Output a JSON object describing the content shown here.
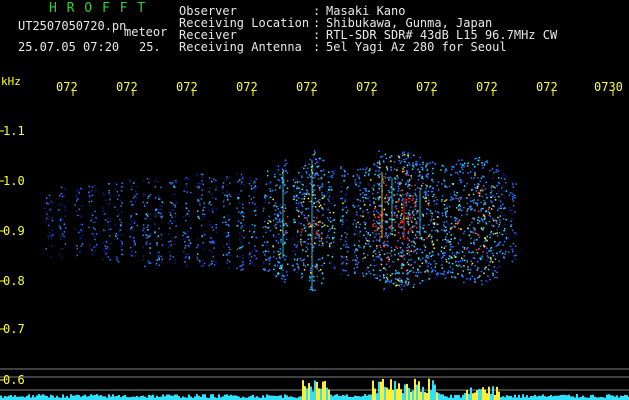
{
  "header": {
    "logo": "H R O F F T",
    "file_name": "UT2507050720.pn",
    "tag": "meteor",
    "datetime": "25.07.05 07:20",
    "frame_id": "25.",
    "fields": [
      {
        "label": "Observer",
        "sep": ":",
        "value": "Masaki Kano"
      },
      {
        "label": "Receiving Location",
        "sep": ":",
        "value": "Shibukawa, Gunma, Japan"
      },
      {
        "label": "Receiver",
        "sep": ":",
        "value": "RTL-SDR SDR# 43dB L15 96.7MHz CW"
      },
      {
        "label": "Receiving Antenna",
        "sep": ":",
        "value": "5el Yagi Az 280 for Seoul"
      }
    ]
  },
  "time_axis": {
    "labels": [
      "072",
      "072",
      "072",
      "072",
      "072",
      "072",
      "072",
      "072",
      "072",
      "0730"
    ]
  },
  "freq_axis": {
    "unit": "kHz",
    "labels": [
      "1.1",
      "1.0",
      "0.9",
      "0.8",
      "0.7",
      "0.6"
    ]
  },
  "colors": {
    "background": "#000000",
    "label": "#ffff30",
    "header_text": "#e8e8e8",
    "logo": "#2fd02f",
    "signal_low": "#10208a",
    "signal_mid": "#2f7bff",
    "signal_high": "#30e0ff",
    "signal_peak": "#ffef30",
    "signal_hot": "#ff3030"
  }
}
